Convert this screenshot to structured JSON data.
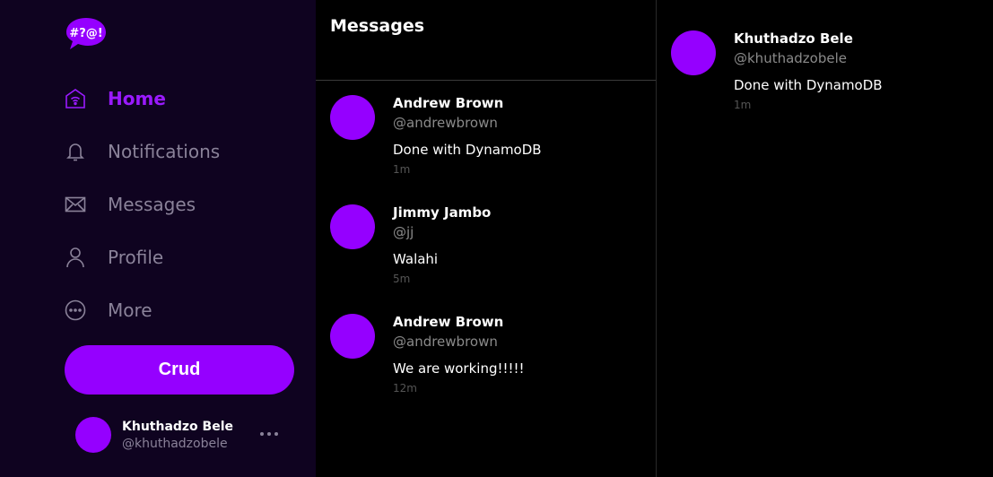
{
  "brand": {
    "logo_text": "#?@!",
    "accent": "#9500ff",
    "sidebar_bg": "#0f0320"
  },
  "nav": {
    "items": [
      {
        "label": "Home",
        "icon": "home-icon",
        "active": true
      },
      {
        "label": "Notifications",
        "icon": "bell-icon",
        "active": false
      },
      {
        "label": "Messages",
        "icon": "envelope-icon",
        "active": false
      },
      {
        "label": "Profile",
        "icon": "user-icon",
        "active": false
      },
      {
        "label": "More",
        "icon": "more-circle-icon",
        "active": false
      }
    ]
  },
  "crud_button": {
    "label": "Crud"
  },
  "current_user": {
    "name": "Khuthadzo Bele",
    "handle": "@khuthadzobele"
  },
  "messages": {
    "title": "Messages",
    "items": [
      {
        "name": "Andrew Brown",
        "handle": "@andrewbrown",
        "text": "Done with DynamoDB",
        "time": "1m"
      },
      {
        "name": "Jimmy Jambo",
        "handle": "@jj",
        "text": "Walahi",
        "time": "5m"
      },
      {
        "name": "Andrew Brown",
        "handle": "@andrewbrown",
        "text": "We are working!!!!!",
        "time": "12m"
      }
    ]
  },
  "thread": {
    "items": [
      {
        "name": "Khuthadzo Bele",
        "handle": "@khuthadzobele",
        "text": "Done with DynamoDB",
        "time": "1m"
      }
    ]
  }
}
